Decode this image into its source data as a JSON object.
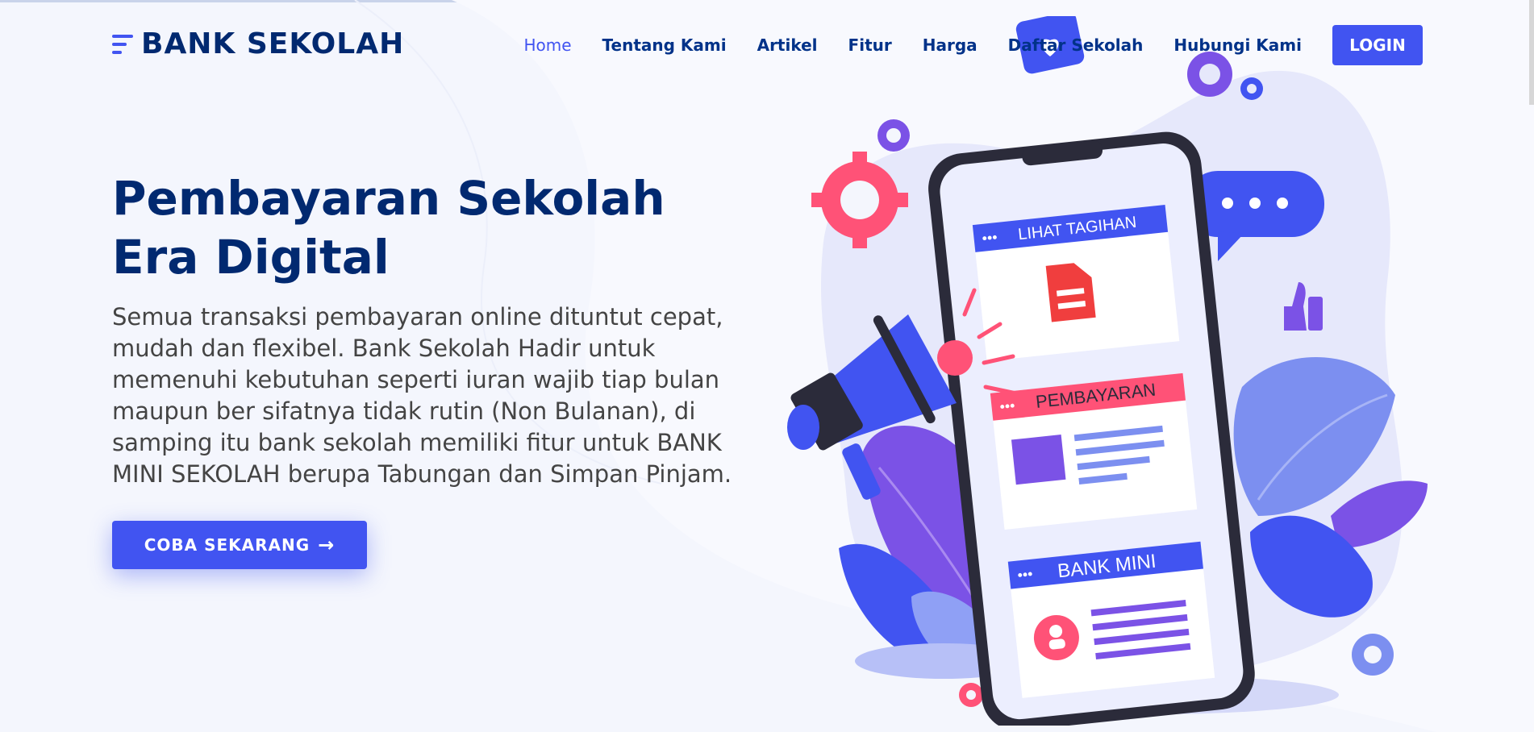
{
  "header": {
    "brand": "BANK SEKOLAH",
    "nav": [
      {
        "label": "Home",
        "active": true
      },
      {
        "label": "Tentang Kami"
      },
      {
        "label": "Artikel"
      },
      {
        "label": "Fitur"
      },
      {
        "label": "Harga"
      },
      {
        "label": "Daftar Sekolah"
      },
      {
        "label": "Hubungi Kami"
      }
    ],
    "login_label": "LOGIN"
  },
  "hero": {
    "title": "Pembayaran Sekolah Era Digital",
    "text": "Semua transaksi pembayaran online dituntut cepat, mudah dan flexibel. Bank Sekolah Hadir untuk memenuhi kebutuhan seperti iuran wajib tiap bulan maupun ber sifatnya tidak rutin (Non Bulanan), di samping itu bank sekolah memiliki fitur untuk BANK MINI SEKOLAH berupa Tabungan dan Simpan Pinjam.",
    "cta_label": "COBA SEKARANG",
    "cta_icon": "arrow-right-icon"
  },
  "illustration": {
    "cards": [
      {
        "label": "LIHAT TAGIHAN"
      },
      {
        "label": "PEMBAYARAN"
      },
      {
        "label": "BANK MINI"
      }
    ]
  },
  "colors": {
    "accent": "#4154f1",
    "navy": "#012970",
    "pink": "#ff5277",
    "purple": "#7b52e6"
  }
}
